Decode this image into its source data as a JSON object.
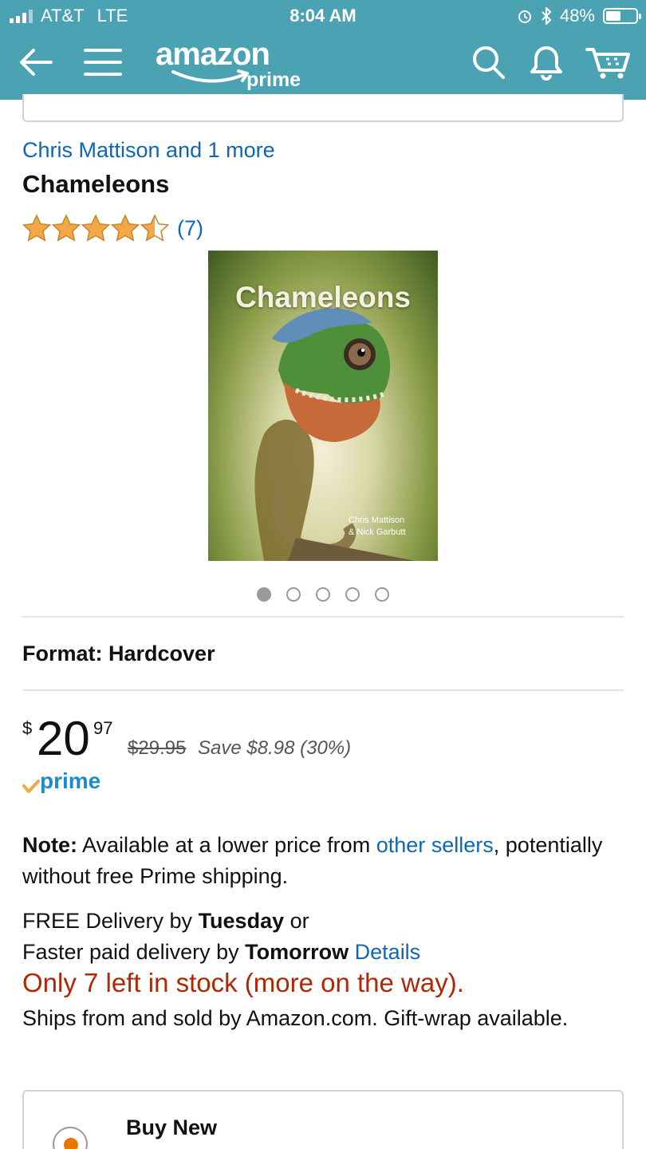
{
  "status_bar": {
    "carrier": "AT&T",
    "network": "LTE",
    "time": "8:04 AM",
    "battery": "48%",
    "battery_level": 0.48
  },
  "header": {
    "logo_word": "amazon",
    "logo_sub": "prime",
    "icons": [
      "back-arrow-icon",
      "menu-icon",
      "search-icon",
      "bell-icon",
      "cart-icon"
    ],
    "background_color": "#4aa2b3"
  },
  "product": {
    "author_link": "Chris Mattison and 1 more",
    "title": "Chameleons",
    "rating_stars": 4.5,
    "rating_count": "(7)",
    "cover": {
      "title": "Chameleons",
      "authors_line1": "Chris Mattison",
      "authors_line2": "& Nick Garbutt"
    },
    "image_count": 5,
    "active_image": 1,
    "format_label": "Format:",
    "format_value": "Hardcover"
  },
  "pricing": {
    "currency": "$",
    "dollars": "20",
    "cents": "97",
    "list_price": "$29.95",
    "savings": "Save $8.98 (30%)",
    "prime_label": "prime"
  },
  "note": {
    "label": "Note:",
    "text_before": "Available at a lower price from",
    "link": "other sellers",
    "text_after": ", potentially without free Prime shipping."
  },
  "delivery": {
    "line1_text": "FREE Delivery by",
    "line1_day": "Tuesday",
    "line1_suffix": "or",
    "line2_text": "Faster paid delivery by",
    "line2_day": "Tomorrow",
    "details_link": "Details"
  },
  "stock": "Only 7 left in stock (more on the way).",
  "ships_from": "Ships from and sold by Amazon.com. Gift-wrap available.",
  "buy_option": {
    "label": "Buy New"
  },
  "colors": {
    "link": "#0f66b4",
    "stock": "#b12704",
    "prime_blue": "#1b8cc9",
    "star": "#f3a847"
  }
}
